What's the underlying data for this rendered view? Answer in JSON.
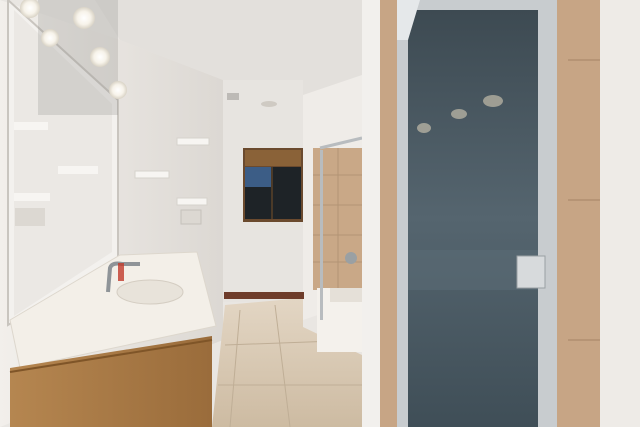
{
  "scene": {
    "type": "photograph",
    "subject": "bathroom",
    "elements": [
      "vanity",
      "wall-mirror",
      "vanity-lights",
      "sink-faucet",
      "wall-shelves",
      "window",
      "bathtub-shower",
      "glass-shower-door",
      "tile-floor"
    ]
  },
  "colors": {
    "wall": "#ece9e5",
    "ceiling": "#e4e1dd",
    "cabinet": "#a87a45",
    "countertop": "#f3efe8",
    "floor_tile": "#d8c7b0",
    "shower_tile": "#c9a887",
    "shower_glass": "#4a5a64",
    "door_frame": "#c8cccf",
    "window_frame": "#6b4a2e"
  }
}
